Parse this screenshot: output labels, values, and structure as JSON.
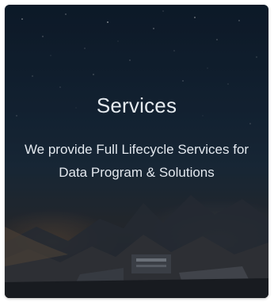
{
  "card": {
    "title": "Services",
    "description": "We provide Full Lifecycle Services for Data Program & Solutions"
  }
}
